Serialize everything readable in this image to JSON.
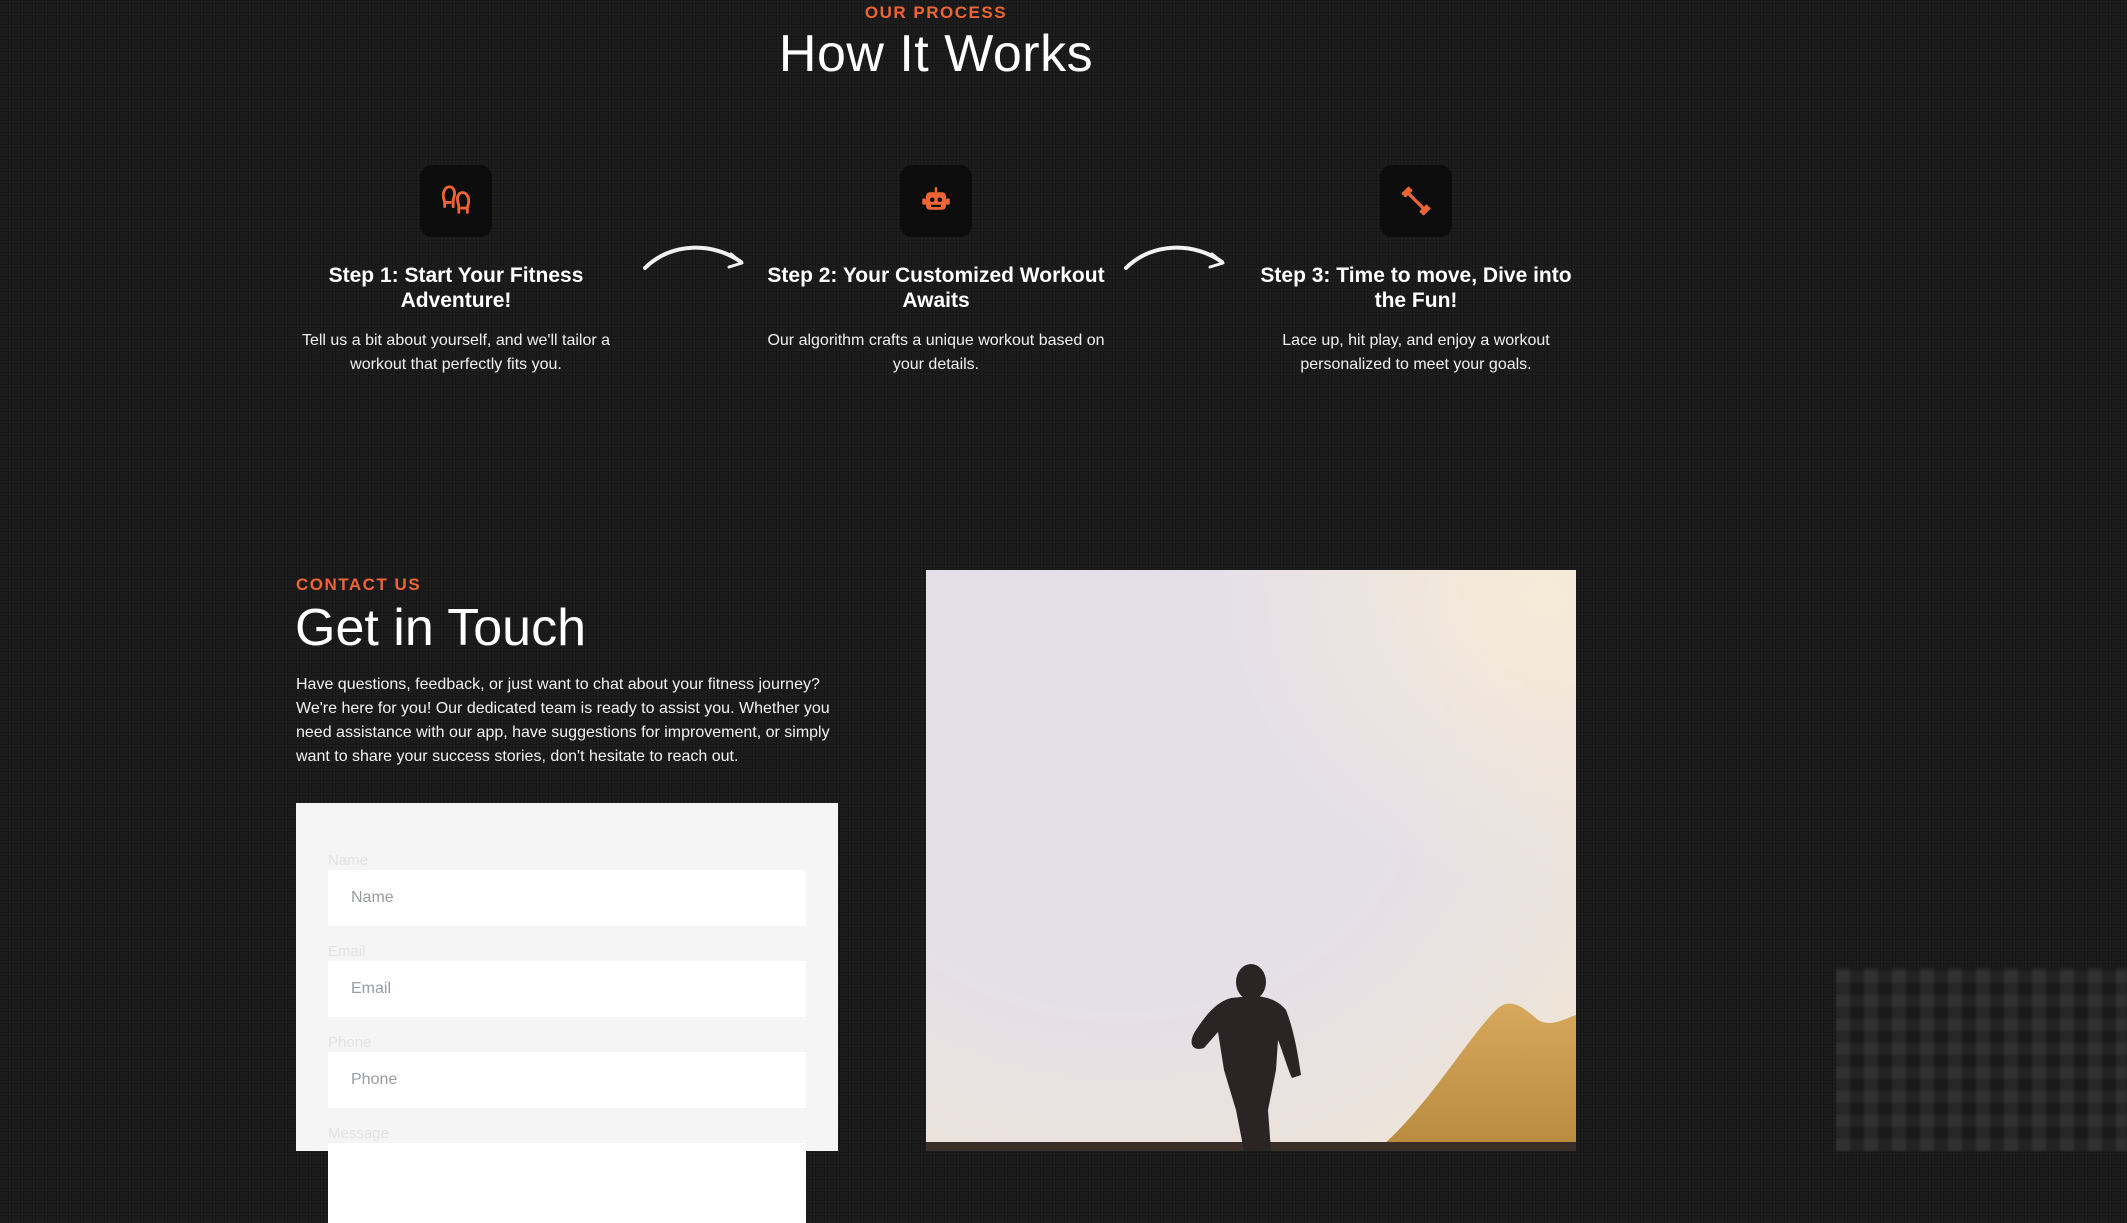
{
  "process": {
    "eyebrow": "OUR PROCESS",
    "title": "How It Works",
    "steps": [
      {
        "icon": "footprints-icon",
        "title": "Step 1: Start Your Fitness Adventure!",
        "description": "Tell us a bit about yourself, and we'll tailor a workout that perfectly fits you."
      },
      {
        "icon": "robot-icon",
        "title": "Step 2: Your Customized Workout Awaits",
        "description": "Our algorithm crafts a unique workout based on your details."
      },
      {
        "icon": "dumbbell-icon",
        "title": "Step 3: Time to move, Dive into the Fun!",
        "description": "Lace up, hit play, and enjoy a workout personalized to meet your goals."
      }
    ]
  },
  "contact": {
    "eyebrow": "CONTACT US",
    "title": "Get in Touch",
    "description": "Have questions, feedback, or just want to chat about your fitness journey? We're here for you! Our dedicated team is ready to assist you. Whether you need assistance with our app, have suggestions for improvement, or simply want to share your success stories, don't hesitate to reach out.",
    "form": {
      "name_label": "Name",
      "name_placeholder": "Name",
      "email_label": "Email",
      "email_placeholder": "Email",
      "phone_label": "Phone",
      "phone_placeholder": "Phone",
      "message_label": "Message"
    }
  },
  "colors": {
    "accent": "#ee6434",
    "background": "#1c1c1c",
    "icon_box": "#0c0c0c",
    "form_card": "#f4f5f4"
  }
}
